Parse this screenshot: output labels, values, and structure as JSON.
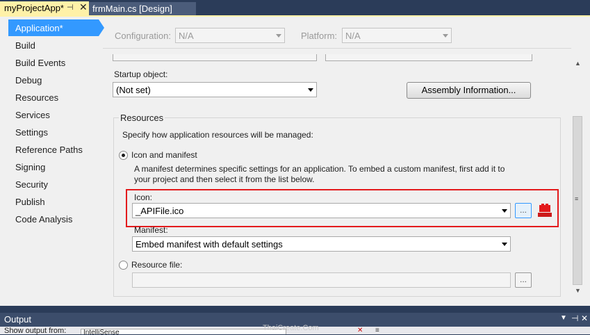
{
  "tabs": [
    {
      "label": "myProjectApp*",
      "active": true
    },
    {
      "label": "frmMain.cs [Design]",
      "active": false
    }
  ],
  "nav": {
    "items": [
      {
        "label": "Application*",
        "active": true
      },
      {
        "label": "Build"
      },
      {
        "label": "Build Events"
      },
      {
        "label": "Debug"
      },
      {
        "label": "Resources"
      },
      {
        "label": "Services"
      },
      {
        "label": "Settings"
      },
      {
        "label": "Reference Paths"
      },
      {
        "label": "Signing"
      },
      {
        "label": "Security"
      },
      {
        "label": "Publish"
      },
      {
        "label": "Code Analysis"
      }
    ]
  },
  "config": {
    "configuration_label": "Configuration:",
    "configuration_value": "N/A",
    "platform_label": "Platform:",
    "platform_value": "N/A"
  },
  "application": {
    "startup_label": "Startup object:",
    "startup_value": "(Not set)",
    "assembly_button": "Assembly Information..."
  },
  "resources": {
    "group_title": "Resources",
    "description": "Specify how application resources will be managed:",
    "icon_manifest_label": "Icon and manifest",
    "manifest_help_line1": "A manifest determines specific settings for an application. To embed a custom manifest, first add it to",
    "manifest_help_line2": "your project and then select it from the list below.",
    "icon_label": "Icon:",
    "icon_value": "_APIFile.ico",
    "browse_label": "...",
    "manifest_label": "Manifest:",
    "manifest_value": "Embed manifest with default settings",
    "resource_file_label": "Resource file:",
    "resource_browse_label": "..."
  },
  "output": {
    "title": "Output",
    "show_output_from": "Show output from:",
    "dropdown_value": "IntelliSense",
    "watermark": "ThaiCreate.Com"
  },
  "colors": {
    "highlight_red": "#e31a1c",
    "nav_active": "#3399ff",
    "tab_active": "#fff1a8"
  }
}
